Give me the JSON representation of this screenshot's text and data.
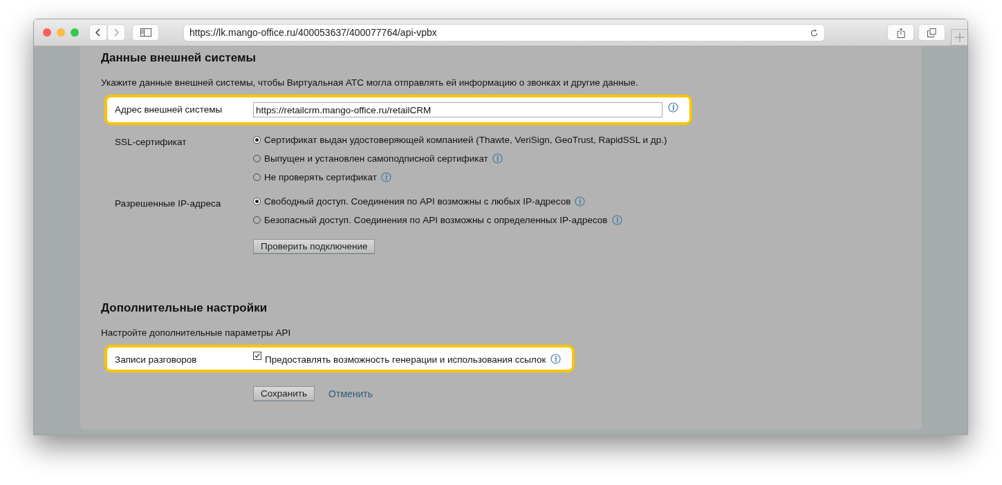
{
  "browser": {
    "url": "https://lk.mango-office.ru/400053637/400077764/api-vpbx"
  },
  "sections": [
    {
      "title": "Данные внешней системы",
      "description": "Укажите данные внешней системы, чтобы Виртуальная АТС могла отправлять ей информацию о звонках и другие данные.",
      "rows": [
        {
          "kind": "text_field",
          "label": "Адрес внешней системы",
          "value": "https://retailcrm.mango-office.ru/retailCRM",
          "info": true,
          "highlighted": true
        },
        {
          "kind": "radio_group",
          "label": "SSL-сертификат",
          "options": [
            {
              "label": "Сертификат выдан удостоверяющей компанией (Thawte, VeriSign, GeoTrust, RapidSSL и др.)",
              "selected": true,
              "info": false
            },
            {
              "label": "Выпущен и установлен самоподписной сертификат",
              "selected": false,
              "info": true
            },
            {
              "label": "Не проверять сертификат",
              "selected": false,
              "info": true
            }
          ]
        },
        {
          "kind": "radio_group",
          "label": "Разрешенные IP-адреса",
          "options": [
            {
              "label": "Свободный доступ. Соединения по API возможны с любых IP-адресов",
              "selected": true,
              "info": true
            },
            {
              "label": "Безопасный доступ. Соединения по API возможны с определенных IP-адресов",
              "selected": false,
              "info": true
            }
          ]
        },
        {
          "kind": "button",
          "label": "Проверить подключение"
        }
      ]
    },
    {
      "title": "Дополнительные настройки",
      "description": "Настройте дополнительные параметры API",
      "rows": [
        {
          "kind": "checkbox",
          "label": "Записи разговоров",
          "option": "Предоставлять возможность генерации и использования ссылок",
          "checked": true,
          "info": true,
          "highlighted": true
        }
      ]
    }
  ],
  "actions": {
    "save": "Сохранить",
    "cancel": "Отменить"
  }
}
